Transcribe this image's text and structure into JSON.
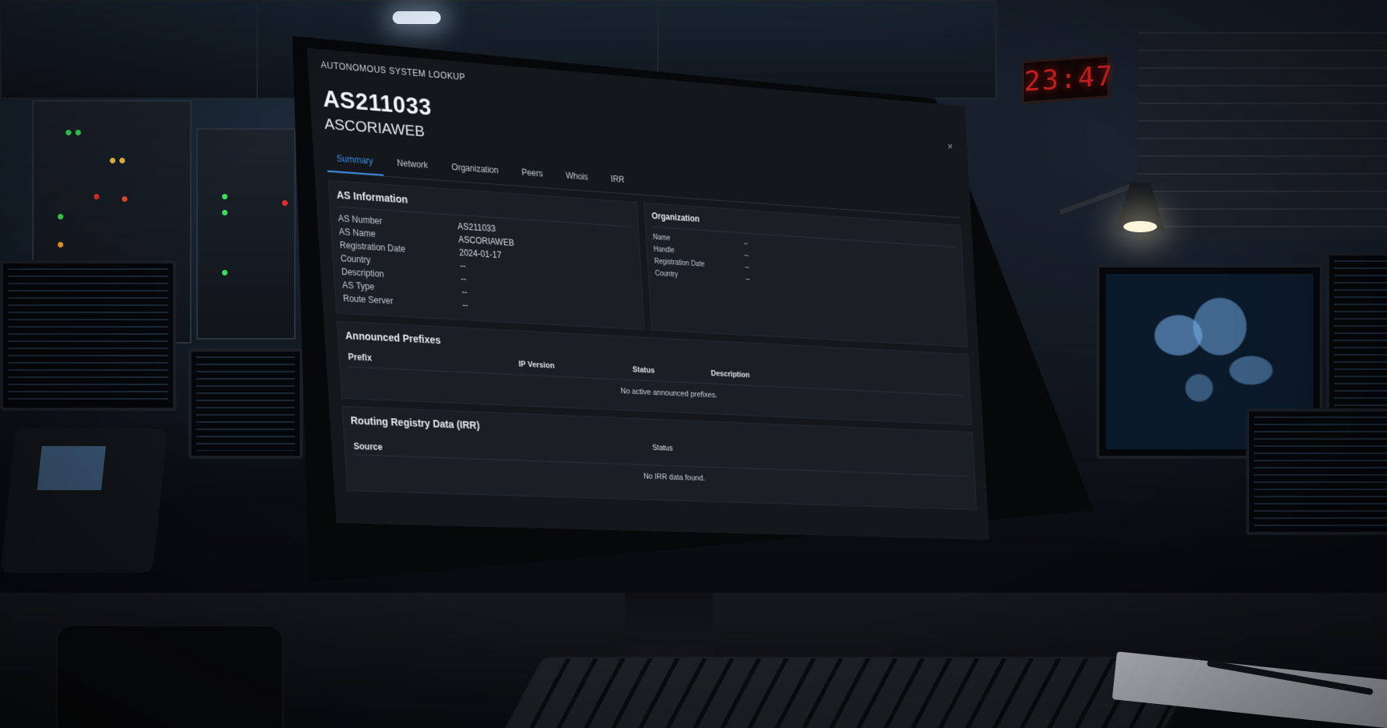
{
  "app": {
    "title": "AUTONOMOUS SYSTEM LOOKUP",
    "close_glyph": "×"
  },
  "header": {
    "as_number": "AS211033",
    "as_name": "ASCORIAWEB"
  },
  "tabs": [
    {
      "label": "Summary",
      "active": true
    },
    {
      "label": "Network",
      "active": false
    },
    {
      "label": "Organization",
      "active": false
    },
    {
      "label": "Peers",
      "active": false
    },
    {
      "label": "Whois",
      "active": false
    },
    {
      "label": "IRR",
      "active": false
    }
  ],
  "as_info": {
    "title": "AS Information",
    "rows": [
      {
        "key": "AS Number",
        "value": "AS211033"
      },
      {
        "key": "AS Name",
        "value": "ASCORIAWEB"
      },
      {
        "key": "Registration Date",
        "value": "2024-01-17"
      },
      {
        "key": "Country",
        "value": "--"
      },
      {
        "key": "Description",
        "value": "--"
      },
      {
        "key": "AS Type",
        "value": "--"
      },
      {
        "key": "Route Server",
        "value": "--"
      }
    ]
  },
  "organization": {
    "title": "Organization",
    "rows": [
      {
        "key": "Name",
        "value": "--"
      },
      {
        "key": "Handle",
        "value": "--"
      },
      {
        "key": "Registration Date",
        "value": "--"
      },
      {
        "key": "Country",
        "value": "--"
      }
    ]
  },
  "prefixes": {
    "title": "Announced Prefixes",
    "columns": {
      "prefix": "Prefix",
      "ip_version": "IP Version",
      "status": "Status",
      "description": "Description"
    },
    "empty_message": "No active announced prefixes."
  },
  "irr": {
    "title": "Routing Registry Data (IRR)",
    "columns": {
      "source": "Source",
      "status": "Status"
    },
    "empty_message": "No IRR data found."
  },
  "room": {
    "wall_clock": "23:47"
  },
  "colors": {
    "accent": "#3b8eea",
    "screen_bg": "#14181d",
    "panel_bg": "#1a1f26",
    "clock_red": "#c42020"
  },
  "icons": {
    "close": "close-icon"
  }
}
